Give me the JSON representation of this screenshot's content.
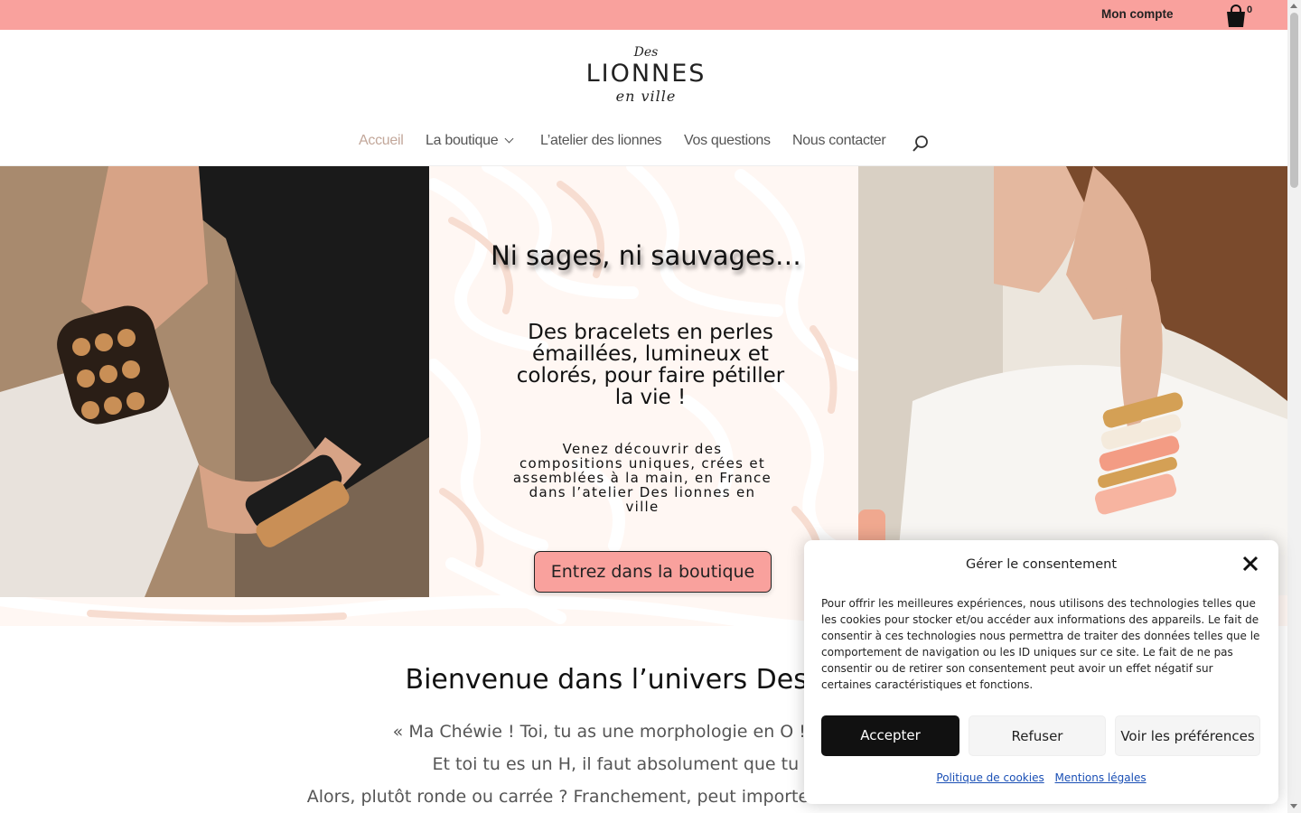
{
  "topbar": {
    "account_label": "Mon compte",
    "cart_count": "0",
    "background": "#f9a19d"
  },
  "logo": {
    "line1": "Des",
    "line2": "LIONNES",
    "line3": "en ville"
  },
  "nav": {
    "items": [
      {
        "label": "Accueil",
        "active": true
      },
      {
        "label": "La boutique",
        "has_submenu": true
      },
      {
        "label": "L’atelier des lionnes"
      },
      {
        "label": "Vos questions"
      },
      {
        "label": "Nous contacter"
      }
    ],
    "search_icon": "search-icon",
    "active_color": "#c2a79a"
  },
  "hero": {
    "title": "Ni sages, ni sauvages…",
    "subtitle": "Des bracelets en perles émaillées, lumineux et colorés, pour faire pétiller la vie !",
    "description": "Venez découvrir des compositions uniques, crées et assemblées à la main, en France dans l’atelier Des lionnes en ville",
    "cta_label": "Entrez dans la boutique",
    "cta_color": "#f9a19d"
  },
  "welcome": {
    "title": "Bienvenue dans l’univers Des lionn",
    "lines": [
      "« Ma Chéwie ! Toi, tu as une morphologie en O ! Tu ne peu",
      "Et toi tu es un H, il faut absolument que tu cache",
      "Alors, plutôt ronde ou carrée ? Franchement, peut importe nos formes … un bi"
    ]
  },
  "consent": {
    "title": "Gérer le consentement",
    "text": "Pour offrir les meilleures expériences, nous utilisons des technologies telles que les cookies pour stocker et/ou accéder aux informations des appareils. Le fait de consentir à ces technologies nous permettra de traiter des données telles que le comportement de navigation ou les ID uniques sur ce site. Le fait de ne pas consentir ou de retirer son consentement peut avoir un effet négatif sur certaines caractéristiques et fonctions.",
    "accept_label": "Accepter",
    "refuse_label": "Refuser",
    "prefs_label": "Voir les préférences",
    "link_cookies": "Politique de cookies",
    "link_legal": "Mentions légales"
  }
}
